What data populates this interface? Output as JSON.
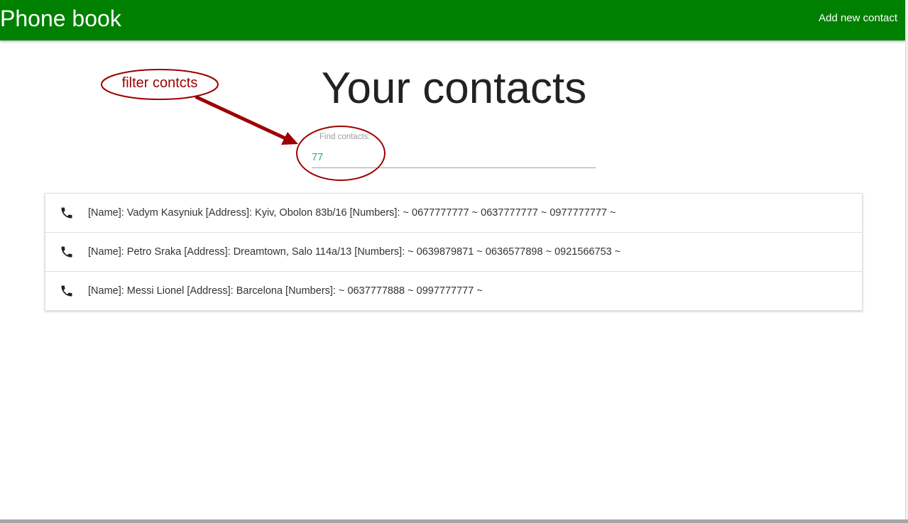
{
  "navbar": {
    "brand": "Phone book",
    "add_contact_label": "Add new contact",
    "color": "#008000"
  },
  "main": {
    "title": "Your contacts",
    "search": {
      "label": "Find contacts:",
      "value": "77"
    },
    "contacts": [
      {
        "icon": "phone-icon",
        "text": "[Name]: Vadym Kasyniuk [Address]: Kyiv, Obolon 83b/16 [Numbers]: ~ 0677777777 ~ 0637777777 ~ 0977777777 ~"
      },
      {
        "icon": "phone-icon",
        "text": "[Name]: Petro Sraka [Address]: Dreamtown, Salo 114a/13 [Numbers]: ~ 0639879871 ~ 0636577898 ~ 0921566753 ~"
      },
      {
        "icon": "phone-icon",
        "text": "[Name]: Messi Lionel [Address]: Barcelona [Numbers]: ~ 0637777888 ~ 0997777777 ~"
      }
    ]
  },
  "annotation": {
    "label": "filter contcts",
    "color": "#9c0000"
  }
}
